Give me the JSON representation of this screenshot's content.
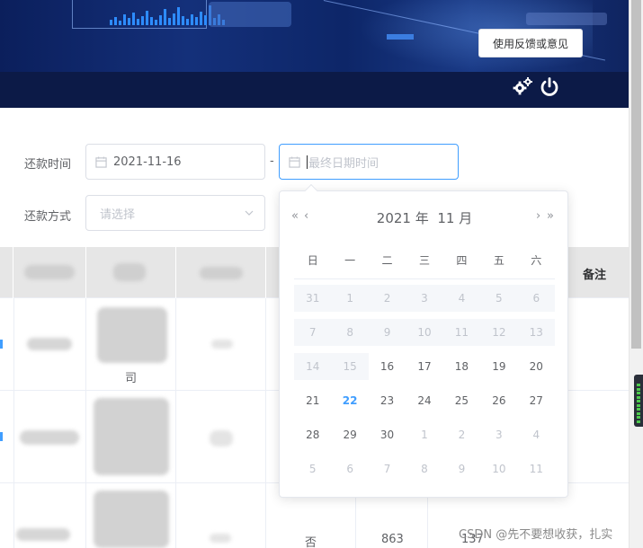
{
  "header": {
    "feedback_label": "使用反馈或意见"
  },
  "form": {
    "repay_time_label": "还款时间",
    "start_date": "2021-11-16",
    "range_separator": "-",
    "end_placeholder": "最终日期时间",
    "repay_method_label": "还款方式",
    "method_placeholder": "请选择"
  },
  "datepicker": {
    "year": "2021",
    "year_unit": "年",
    "month": "11",
    "month_unit": "月",
    "prev_year": "«",
    "prev_month": "‹",
    "next_month": "›",
    "next_year": "»",
    "weekdays": [
      "日",
      "一",
      "二",
      "三",
      "四",
      "五",
      "六"
    ],
    "days": [
      {
        "d": "31",
        "s": "disabled"
      },
      {
        "d": "1",
        "s": "disabled"
      },
      {
        "d": "2",
        "s": "disabled"
      },
      {
        "d": "3",
        "s": "disabled"
      },
      {
        "d": "4",
        "s": "disabled"
      },
      {
        "d": "5",
        "s": "disabled"
      },
      {
        "d": "6",
        "s": "disabled"
      },
      {
        "d": "7",
        "s": "disabled"
      },
      {
        "d": "8",
        "s": "disabled"
      },
      {
        "d": "9",
        "s": "disabled"
      },
      {
        "d": "10",
        "s": "disabled"
      },
      {
        "d": "11",
        "s": "disabled"
      },
      {
        "d": "12",
        "s": "disabled"
      },
      {
        "d": "13",
        "s": "disabled"
      },
      {
        "d": "14",
        "s": "disabled"
      },
      {
        "d": "15",
        "s": "disabled"
      },
      {
        "d": "16",
        "s": ""
      },
      {
        "d": "17",
        "s": ""
      },
      {
        "d": "18",
        "s": ""
      },
      {
        "d": "19",
        "s": ""
      },
      {
        "d": "20",
        "s": ""
      },
      {
        "d": "21",
        "s": ""
      },
      {
        "d": "22",
        "s": "today"
      },
      {
        "d": "23",
        "s": ""
      },
      {
        "d": "24",
        "s": ""
      },
      {
        "d": "25",
        "s": ""
      },
      {
        "d": "26",
        "s": ""
      },
      {
        "d": "27",
        "s": ""
      },
      {
        "d": "28",
        "s": ""
      },
      {
        "d": "29",
        "s": ""
      },
      {
        "d": "30",
        "s": ""
      },
      {
        "d": "1",
        "s": "off"
      },
      {
        "d": "2",
        "s": "off"
      },
      {
        "d": "3",
        "s": "off"
      },
      {
        "d": "4",
        "s": "off"
      },
      {
        "d": "5",
        "s": "off"
      },
      {
        "d": "6",
        "s": "off"
      },
      {
        "d": "7",
        "s": "off"
      },
      {
        "d": "8",
        "s": "off"
      },
      {
        "d": "9",
        "s": "off"
      },
      {
        "d": "10",
        "s": "off"
      },
      {
        "d": "11",
        "s": "off"
      }
    ]
  },
  "table": {
    "note_header": "备注",
    "row1_tail": "司",
    "row3_flag": "否",
    "row3_value": "863",
    "row3_value2": "137"
  },
  "colors": {
    "accent": "#409eff",
    "banner": "#0c1a47",
    "disabled_bg": "#f5f7fa"
  },
  "watermark": "CSDN @先不要想收获，扎实"
}
